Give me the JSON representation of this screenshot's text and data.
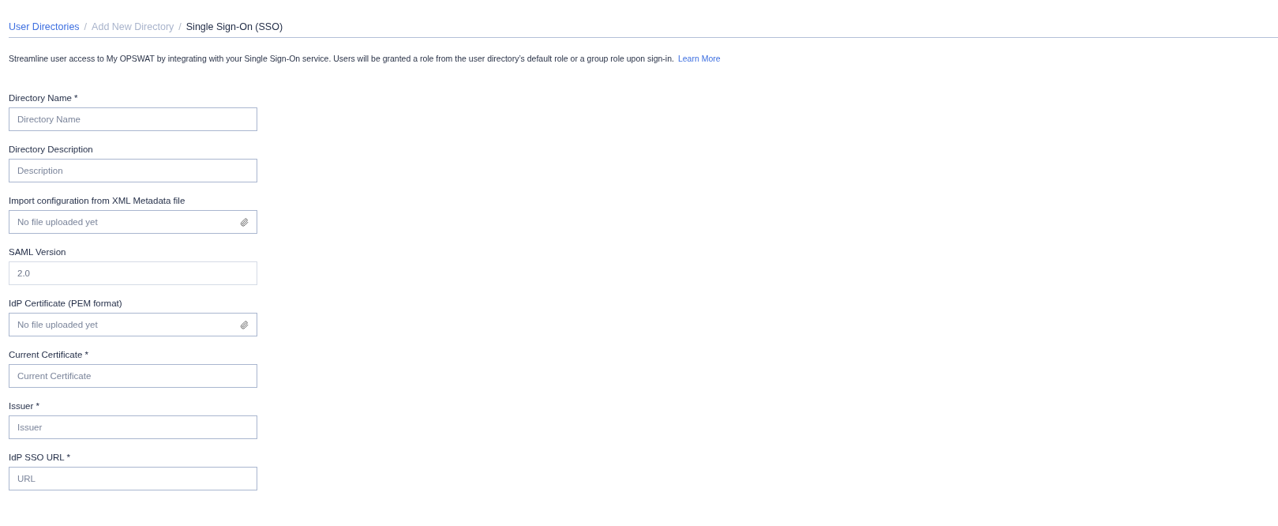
{
  "breadcrumb": [
    {
      "label": "User Directories",
      "kind": "link"
    },
    {
      "label": "/",
      "kind": "separator"
    },
    {
      "label": "Add New Directory",
      "kind": "muted"
    },
    {
      "label": "/",
      "kind": "separator"
    },
    {
      "label": "Single Sign-On (SSO)",
      "kind": "current"
    }
  ],
  "intro": {
    "text": "Streamline user access to My OPSWAT by integrating with your Single Sign-On service. Users will be granted a role from the user directory’s default role or a group role upon sign-in.",
    "link": "Learn More"
  },
  "fields": [
    {
      "label": "Directory Name *",
      "kind": "text",
      "placeholder": "Directory Name",
      "disabled": false
    },
    {
      "label": "Directory Description",
      "kind": "text",
      "placeholder": "Description",
      "disabled": false
    },
    {
      "label": "Import configuration from XML Metadata file",
      "kind": "file",
      "placeholder": "No file uploaded yet",
      "disabled": false
    },
    {
      "label": "SAML Version",
      "kind": "text",
      "value": "2.0",
      "disabled": true
    },
    {
      "label": "IdP Certificate (PEM format)",
      "kind": "file",
      "placeholder": "No file uploaded yet",
      "disabled": false
    },
    {
      "label": "Current Certificate *",
      "kind": "text",
      "placeholder": "Current Certificate",
      "disabled": false
    },
    {
      "label": "Issuer *",
      "kind": "text",
      "placeholder": "Issuer",
      "disabled": false
    },
    {
      "label": "IdP SSO URL *",
      "kind": "text",
      "placeholder": "URL",
      "disabled": false
    }
  ]
}
